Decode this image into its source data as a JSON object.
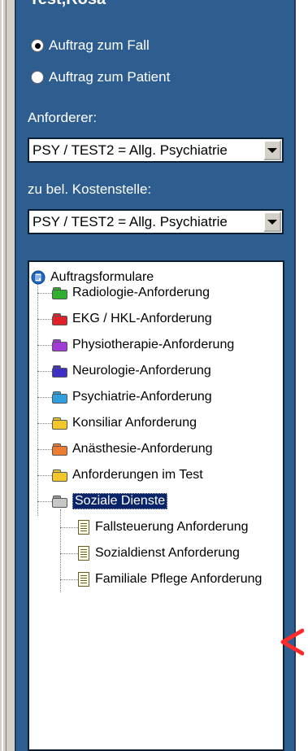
{
  "patient_name": "Test,Rosa",
  "radios": [
    {
      "label": "Auftrag zum Fall",
      "checked": true
    },
    {
      "label": "Auftrag zum Patient",
      "checked": false
    }
  ],
  "requester": {
    "label": "Anforderer:",
    "value": "PSY / TEST2 = Allg. Psychiatrie"
  },
  "cost_center": {
    "label": "zu bel. Kostenstelle:",
    "value": "PSY / TEST2 = Allg. Psychiatrie"
  },
  "tree": {
    "root": "Auftragsformulare",
    "folders": [
      {
        "label": "Radiologie-Anforderung",
        "color": "#2fb12f",
        "icon": "folder-icon-green"
      },
      {
        "label": "EKG / HKL-Anforderung",
        "color": "#e0222a",
        "icon": "folder-icon-red"
      },
      {
        "label": "Physiotherapie-Anforderung",
        "color": "#a23bd6",
        "icon": "folder-icon-purple"
      },
      {
        "label": "Neurologie-Anforderung",
        "color": "#3e2fc6",
        "icon": "folder-icon-blue"
      },
      {
        "label": "Psychiatrie-Anforderung",
        "color": "#2f9fde",
        "icon": "folder-icon-lightblue"
      },
      {
        "label": "Konsiliar Anforderung",
        "color": "#f3c72a",
        "icon": "folder-icon-yellow"
      },
      {
        "label": "Anästhesie-Anforderung",
        "color": "#ee7d31",
        "icon": "folder-icon-orange"
      },
      {
        "label": "Anforderungen im Test",
        "color": "#f3c72a",
        "icon": "folder-icon-yellow"
      },
      {
        "label": "Soziale Dienste",
        "color": "#9a9a9a",
        "icon": "folder-icon-gray",
        "selected": true
      }
    ],
    "documents": [
      {
        "label": "Fallsteuerung Anforderung",
        "icon": "document-icon"
      },
      {
        "label": "Sozialdienst Anforderung",
        "icon": "document-icon"
      },
      {
        "label": "Familiale Pflege Anforderung",
        "icon": "document-icon"
      }
    ]
  },
  "colors": {
    "panel_bg": "#2e5d8f",
    "selection_bg": "#0a246a",
    "annotation_arrow": "#ff2a2a"
  }
}
